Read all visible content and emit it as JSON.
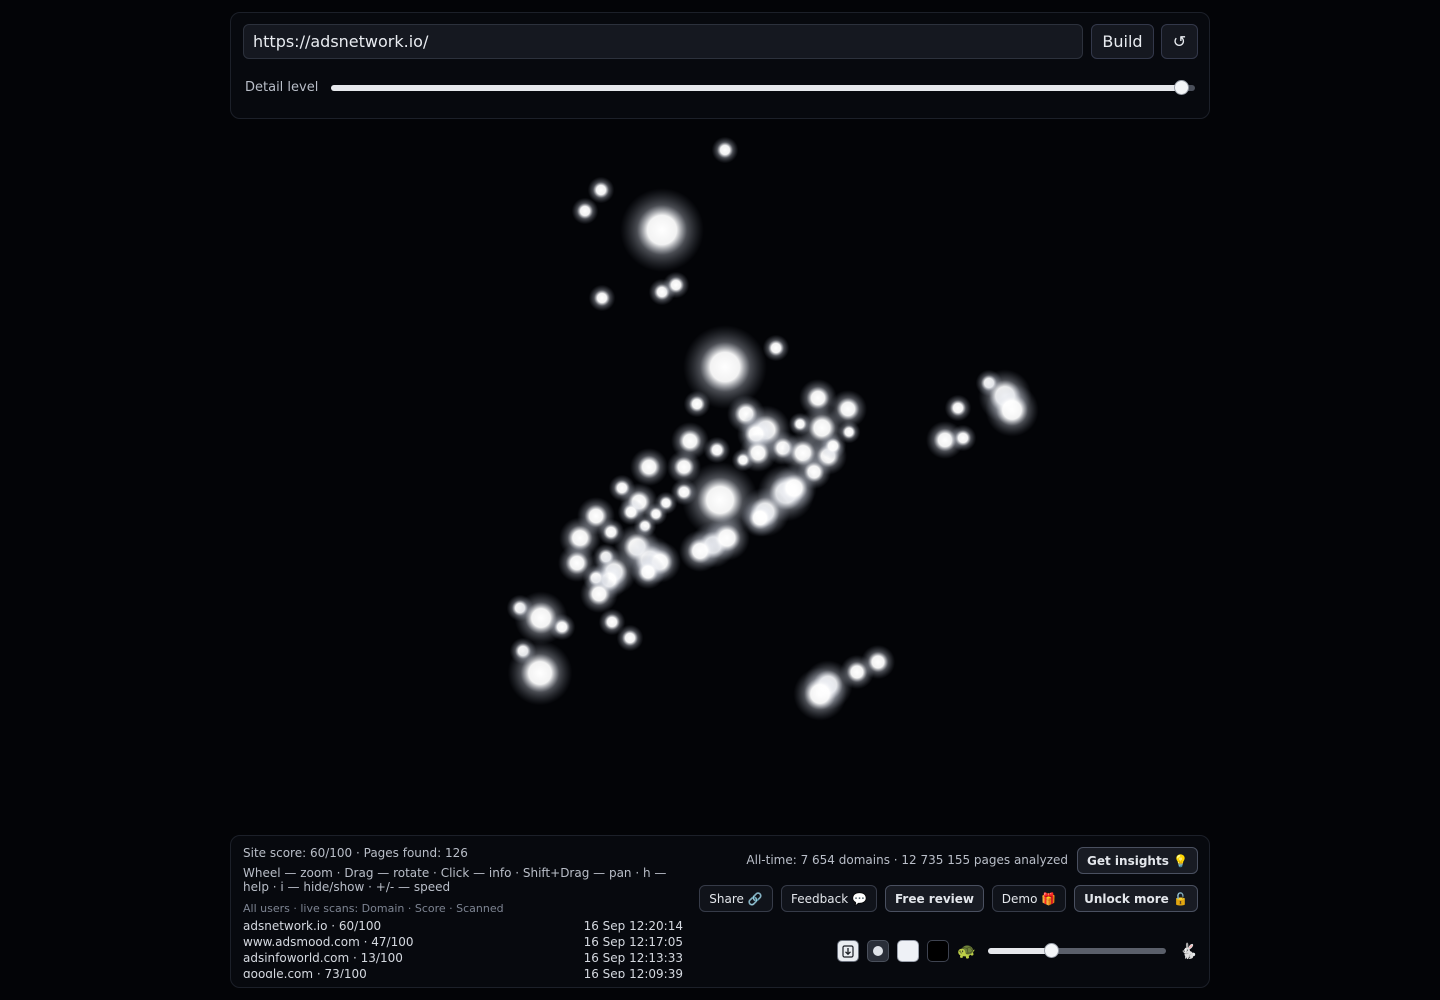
{
  "toolbar": {
    "url_value": "https://adsnetwork.io/",
    "build_label": "Build",
    "reload_glyph": "↺",
    "detail_label": "Detail level",
    "detail_level": 0.985
  },
  "stats": {
    "site": "Site score: 60/100 · Pages found: 126",
    "help": "Wheel — zoom · Drag — rotate · Click — info · Shift+Drag — pan · h — help · i — hide/show · +/- — speed",
    "scans_header": "All users · live scans: Domain · Score · Scanned",
    "alltime": "All-time: 7 654 domains · 12 735 155 pages analyzed"
  },
  "scans": [
    {
      "domain": "adsnetwork.io · 60/100",
      "time": "16 Sep 12:20:14"
    },
    {
      "domain": "www.adsmood.com · 47/100",
      "time": "16 Sep 12:17:05"
    },
    {
      "domain": "adsinfoworld.com · 13/100",
      "time": "16 Sep 12:13:33"
    },
    {
      "domain": "google.com · 73/100",
      "time": "16 Sep 12:09:39"
    }
  ],
  "buttons": {
    "insights": "Get insights 💡",
    "share": "Share 🔗",
    "feedback": "Feedback 💬",
    "review": "Free review",
    "demo": "Demo 🎁",
    "unlock": "Unlock more 🔓"
  },
  "speed": {
    "slow_glyph": "🐢",
    "fast_glyph": "🐇",
    "level": 0.36
  },
  "icons": {
    "download": "download-icon",
    "dot": "dot-icon",
    "light": "light-theme-icon",
    "dark": "dark-theme-icon"
  }
}
